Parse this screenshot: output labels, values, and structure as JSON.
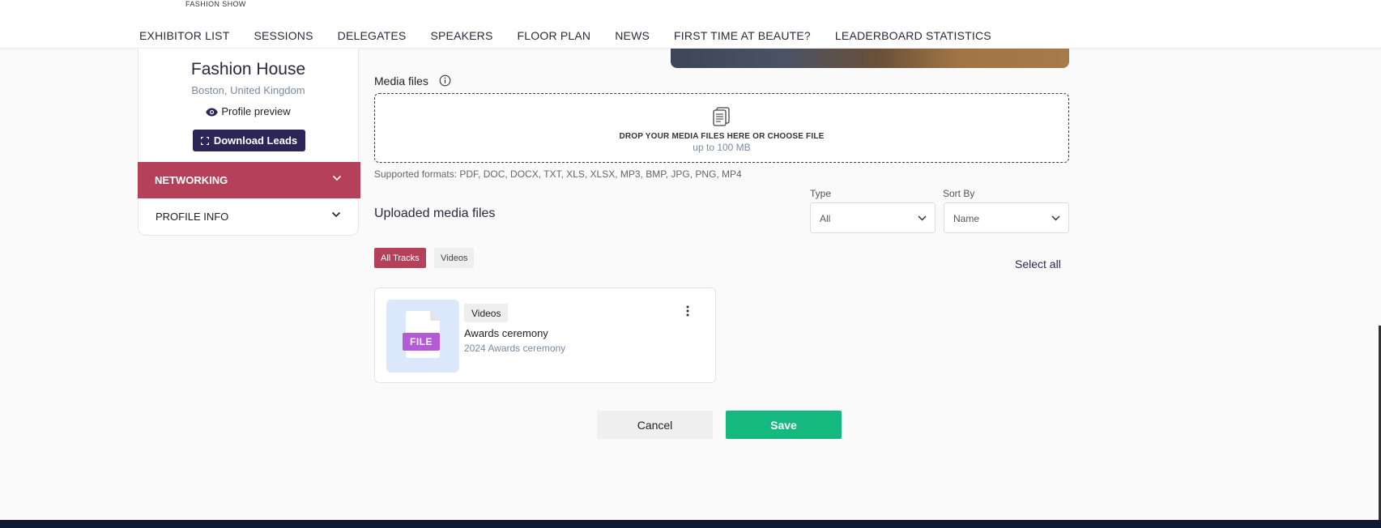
{
  "header": {
    "brand_subtitle": "FASHION SHOW",
    "nav": [
      "EXHIBITOR LIST",
      "SESSIONS",
      "DELEGATES",
      "SPEAKERS",
      "FLOOR PLAN",
      "NEWS",
      "FIRST TIME AT BEAUTE?",
      "LEADERBOARD STATISTICS"
    ]
  },
  "sidebar": {
    "company_name": "Fashion House",
    "location": "Boston, United Kingdom",
    "profile_preview": "Profile preview",
    "download_leads": "Download Leads",
    "sections": [
      "NETWORKING",
      "PROFILE INFO"
    ],
    "active_color": "#b5405a"
  },
  "media": {
    "label": "Media files",
    "drop_text": "DROP YOUR MEDIA FILES HERE OR CHOOSE FILE",
    "size_limit": "up to 100 MB",
    "formats": "Supported formats: PDF, DOC, DOCX, TXT, XLS, XLSX, MP3, BMP, JPG, PNG, MP4"
  },
  "uploaded": {
    "title": "Uploaded media files",
    "type_label": "Type",
    "type_value": "All",
    "sort_label": "Sort By",
    "sort_value": "Name",
    "filters": [
      "All Tracks",
      "Videos"
    ],
    "select_all": "Select all",
    "items": [
      {
        "badge": "FILE",
        "tag": "Videos",
        "title": "Awards ceremony",
        "subtitle": "2024 Awards ceremony"
      }
    ]
  },
  "actions": {
    "cancel": "Cancel",
    "save": "Save",
    "save_color": "#15b980"
  }
}
